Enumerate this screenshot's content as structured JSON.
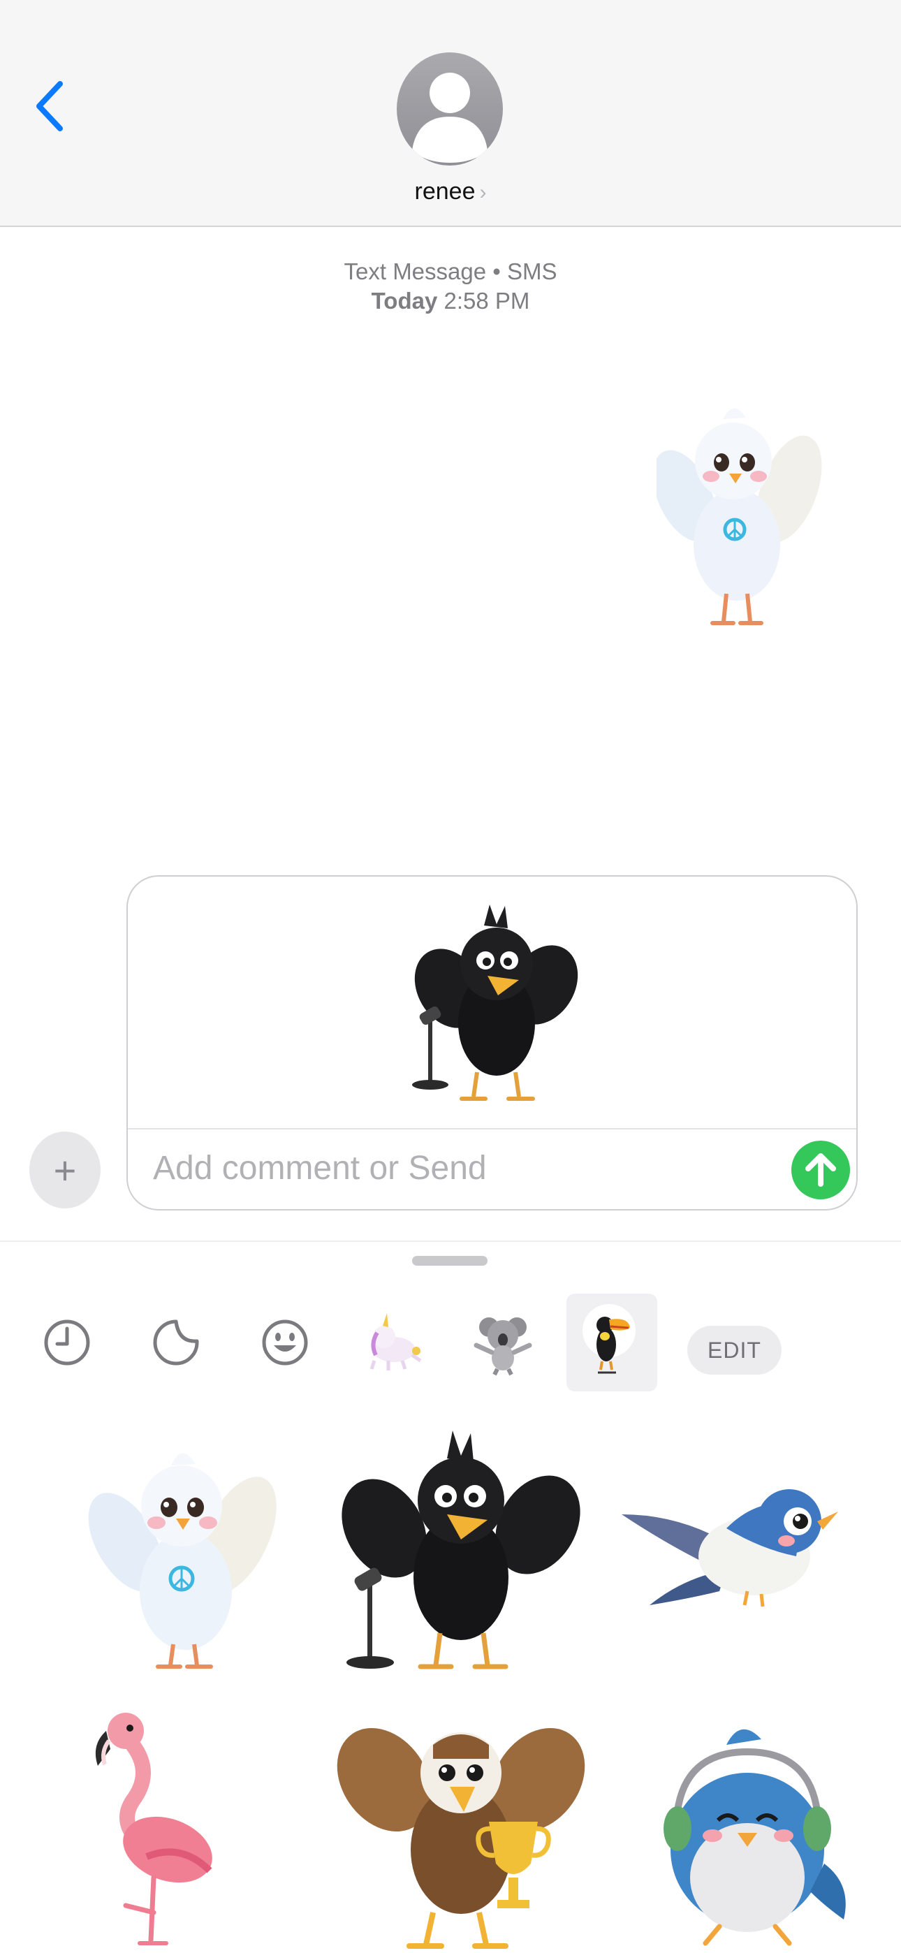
{
  "header": {
    "back_icon": "chevron-left-icon",
    "contact_name": "renee",
    "chevron": "›"
  },
  "conversation": {
    "service_label": "Text Message • SMS",
    "date_prefix": "Today",
    "time": "2:58 PM",
    "sent_sticker": "white-dove-peace-sticker"
  },
  "composer": {
    "plus_label": "+",
    "attached_sticker": "black-crow-microphone-sticker",
    "placeholder": "Add comment or Send",
    "send_icon": "arrow-up-icon"
  },
  "drawer": {
    "tabs": [
      {
        "name": "recents-tab",
        "icon": "clock-icon"
      },
      {
        "name": "stickers-tab",
        "icon": "sticker-peel-icon"
      },
      {
        "name": "emoji-tab",
        "icon": "smiley-icon"
      },
      {
        "name": "unicorn-pack-tab",
        "icon": "unicorn-sticker-icon"
      },
      {
        "name": "koala-pack-tab",
        "icon": "koala-sticker-icon"
      },
      {
        "name": "toucan-pack-tab",
        "icon": "toucan-sticker-icon",
        "selected": true
      }
    ],
    "edit_label": "EDIT",
    "stickers": [
      "white-dove-sticker",
      "black-crow-sticker",
      "blue-swallow-sticker",
      "pink-flamingo-sticker",
      "eagle-trophy-sticker",
      "bluebird-headphones-sticker"
    ]
  },
  "colors": {
    "accent_blue": "#0a7aff",
    "send_green": "#34c759",
    "header_bg": "#f6f6f7",
    "secondary_text": "#7d7d82"
  }
}
